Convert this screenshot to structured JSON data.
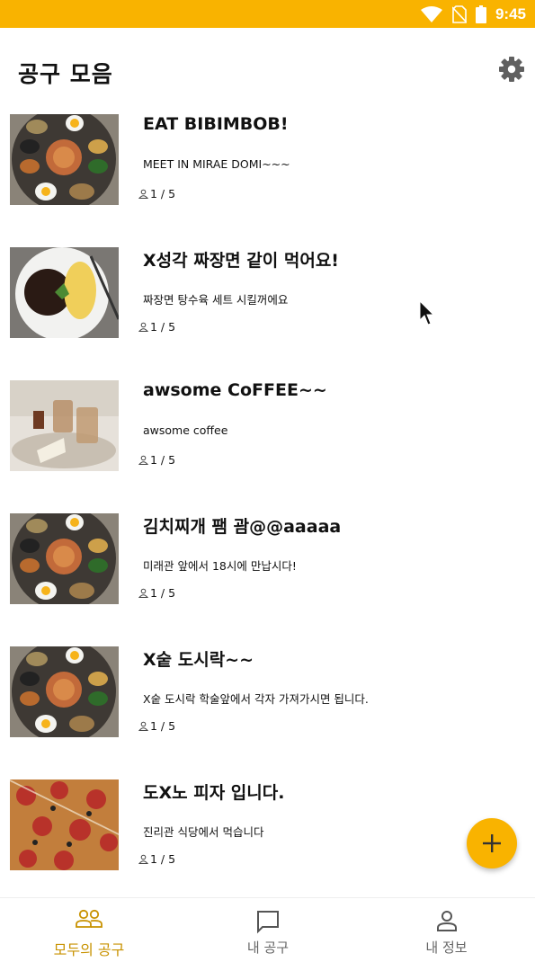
{
  "status_bar": {
    "time": "9:45"
  },
  "header": {
    "title": "공구 모음"
  },
  "posts": [
    {
      "title": "EAT BIBIMBOB!",
      "desc": "MEET IN MIRAE DOMI~~~",
      "count": "1 / 5",
      "image": "korean-table-meal"
    },
    {
      "title": "X성각 짜장면 같이 먹어요!",
      "desc": "짜장면 탕수육 세트 시킬꺼에요",
      "count": "1 / 5",
      "image": "jajangmyeon"
    },
    {
      "title": "awsome CoFFEE~~",
      "desc": "awsome coffee",
      "count": "1 / 5",
      "image": "coffee-and-cake"
    },
    {
      "title": "김치찌개 팸 괌@@aaaaa",
      "desc": "미래관 앞에서 18시에 만납시다!",
      "count": "1 / 5",
      "image": "korean-table-meal"
    },
    {
      "title": "X숱 도시락~~",
      "desc": "X숱 도시락 학술앞에서 각자 가져가시면 됩니다.",
      "count": "1 / 5",
      "image": "korean-table-meal"
    },
    {
      "title": "도X노 피자 입니다.",
      "desc": "진리관 식당에서 먹습니다",
      "count": "1 / 5",
      "image": "pizza"
    }
  ],
  "bottom_nav": [
    {
      "label": "모두의 공구",
      "icon": "group-icon",
      "active": true
    },
    {
      "label": "내 공구",
      "icon": "chat-icon",
      "active": false
    },
    {
      "label": "내 정보",
      "icon": "person-icon",
      "active": false
    }
  ],
  "colors": {
    "accent": "#f9b300",
    "active_nav": "#c89200"
  }
}
